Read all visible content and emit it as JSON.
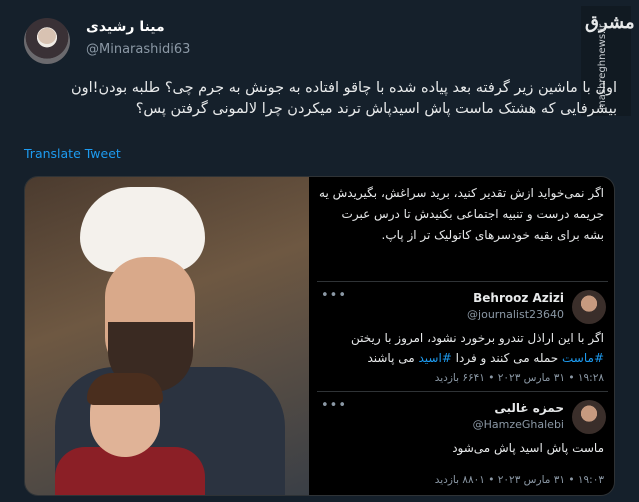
{
  "tweet": {
    "author_name": "مینا رشیدی",
    "author_handle": "@Minarashidi63",
    "text": "اول با ماشین زیر گرفته بعد پیاده شده با چاقو افتاده به جونش به جرم چی؟ طلبه بودن!اون بیشرفایی که هشتک ماست پاش اسیدپاش ترند میکردن چرا لالمونی گرفتن پس؟",
    "translate_label": "Translate Tweet"
  },
  "logo": {
    "mark": "مشرق",
    "site": "mashreghnews.ir"
  },
  "screenshot": {
    "quote_text": "اگر نمی‌خواید ازش تقدیر کنید، برید سراغش، بگیریدش یه جریمه درست و تنبیه اجتماعی بکنیدش تا درس عبرت بشه برای بقیه خودسرهای کاتولیک تر از پاپ.",
    "cards": [
      {
        "name": "Behrooz Azizi",
        "handle": "@journalist23640",
        "text_before": "اگر با این اراذل تندرو برخورد نشود، امروز با ریختن ",
        "hashtag1": "#ماست",
        "text_middle": " حمله می کنند و فردا ",
        "hashtag2": "#اسید",
        "text_after": " می پاشند",
        "meta": "۱۹:۲۸ • ۳۱ مارس ۲۰۲۳ • ۶۶۴۱ بازدید"
      },
      {
        "name": "حمزه غالبی",
        "handle": "@HamzeGhalebi",
        "text": "ماست پاش اسید پاش می‌شود",
        "meta": "۱۹:۰۳ • ۳۱ مارس ۲۰۲۳ • ۸۸۰۱ بازدید"
      }
    ],
    "more_glyph": "•••"
  }
}
